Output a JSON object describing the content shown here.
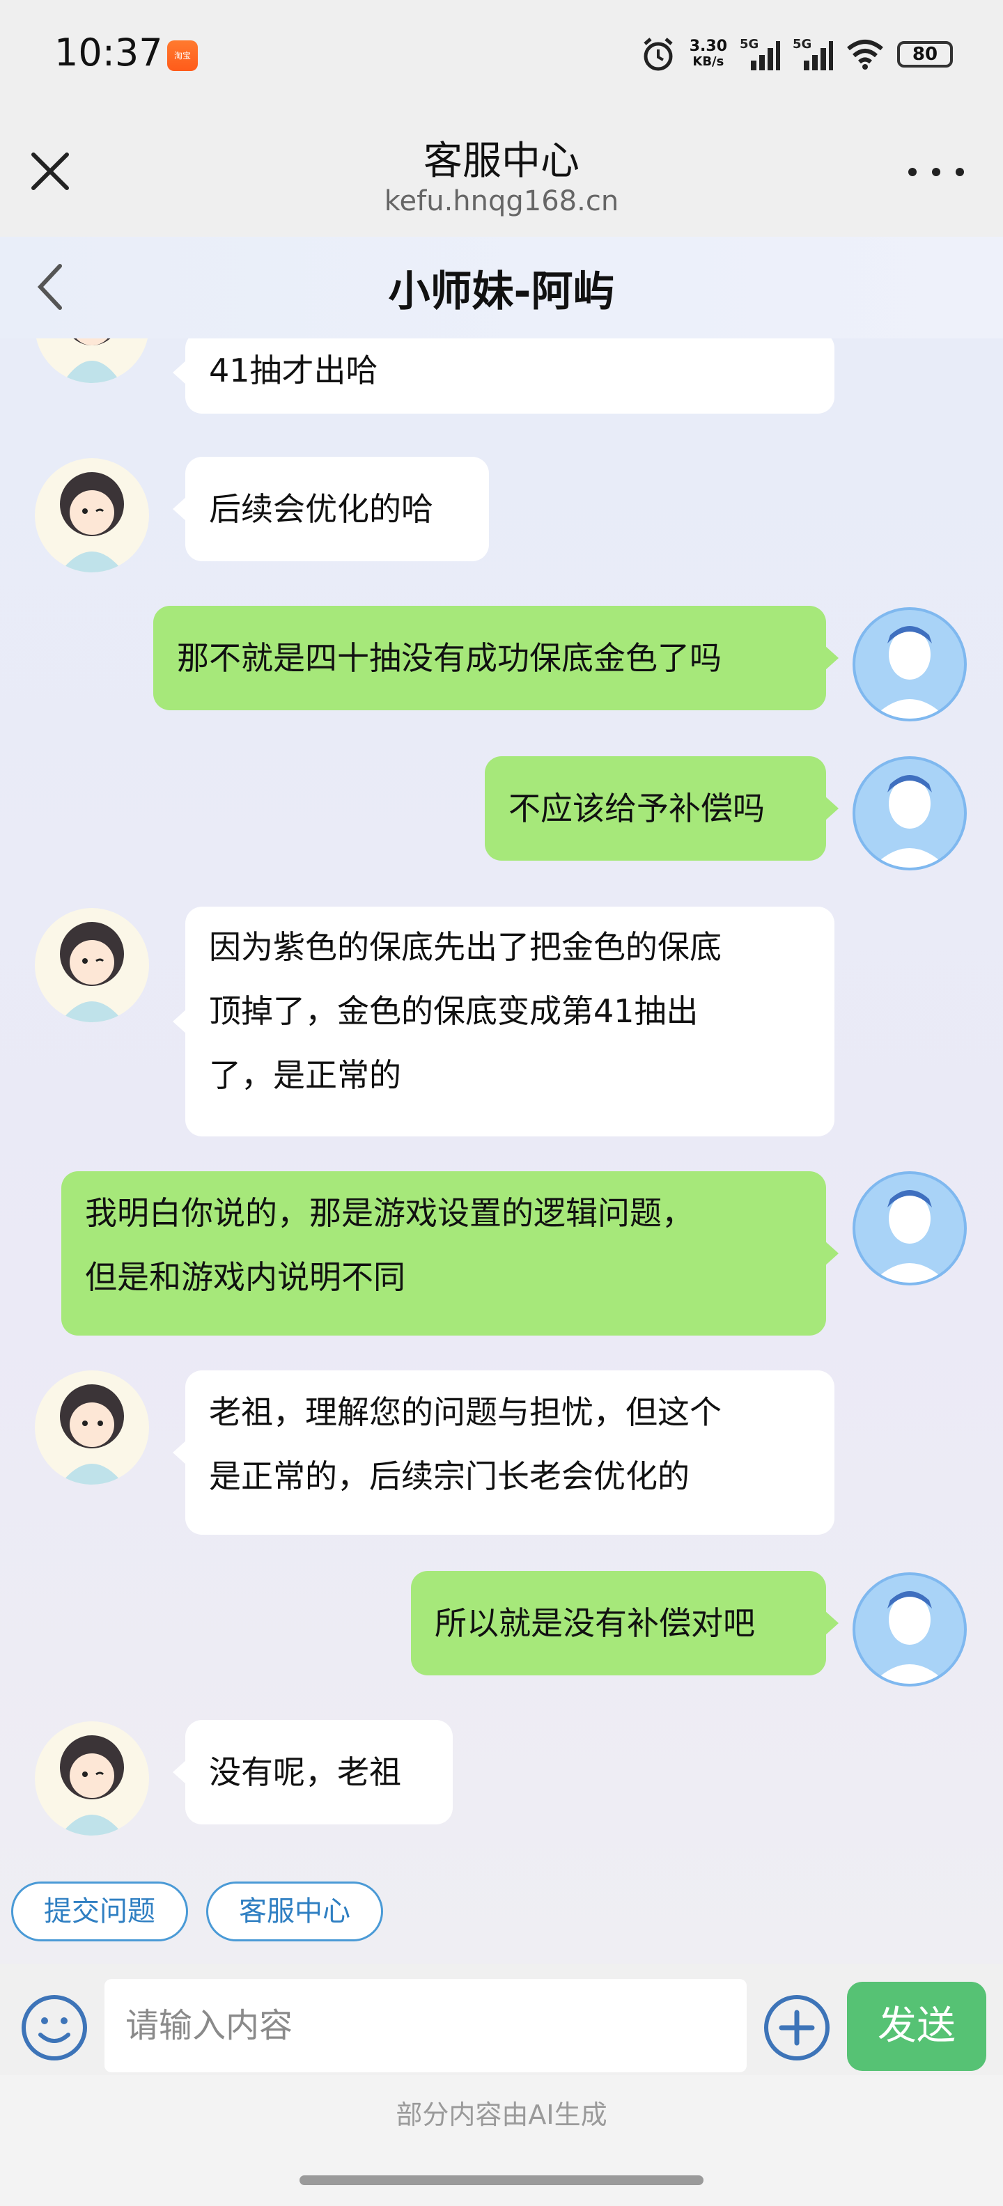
{
  "status_bar": {
    "time": "10:37",
    "app_icon_label": "淘宝",
    "network_speed": "3.30",
    "network_unit": "KB/s",
    "signal1": "5G",
    "signal2": "5G",
    "battery": "80"
  },
  "browser": {
    "title": "客服中心",
    "url": "kefu.hnqg168.cn"
  },
  "chat": {
    "title": "小师妹-阿屿"
  },
  "messages": [
    {
      "side": "agent",
      "text": "41抽才出哈"
    },
    {
      "side": "agent",
      "text": "后续会优化的哈"
    },
    {
      "side": "user",
      "text": "那不就是四十抽没有成功保底金色了吗"
    },
    {
      "side": "user",
      "text": "不应该给予补偿吗"
    },
    {
      "side": "agent",
      "lines": [
        "因为紫色的保底先出了把金色的保底",
        "顶掉了，金色的保底变成第41抽出",
        "了，是正常的"
      ]
    },
    {
      "side": "user",
      "lines": [
        "我明白你说的，那是游戏设置的逻辑问题，",
        "但是和游戏内说明不同"
      ]
    },
    {
      "side": "agent",
      "lines": [
        "老祖，理解您的问题与担忧，但这个",
        "是正常的，后续宗门长老会优化的"
      ]
    },
    {
      "side": "user",
      "text": "所以就是没有补偿对吧"
    },
    {
      "side": "agent",
      "text": "没有呢，老祖"
    }
  ],
  "quick_actions": [
    "提交问题",
    "客服中心"
  ],
  "input": {
    "placeholder": "请输入内容",
    "send_label": "发送"
  },
  "footer_note": "部分内容由AI生成",
  "colors": {
    "user_bubble": "#a6e87a",
    "agent_bubble": "#ffffff",
    "send_button": "#56c274",
    "quick_border": "#4a9ad6"
  }
}
